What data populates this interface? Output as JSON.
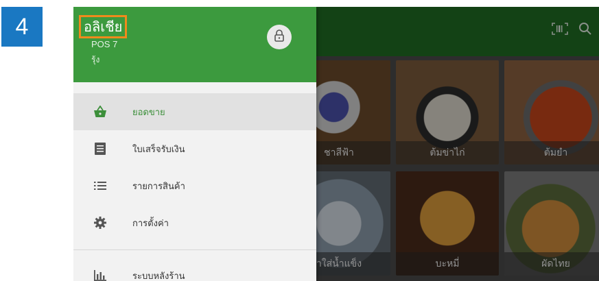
{
  "step_number": "4",
  "drawer": {
    "user_name": "อลิเชีย",
    "pos_label": "POS 7",
    "role_label": "รุ้ง",
    "menu_items": [
      {
        "label": "ยอดขาย",
        "icon": "basket-icon",
        "active": true
      },
      {
        "label": "ใบเสร็จรับเงิน",
        "icon": "receipt-icon",
        "active": false
      },
      {
        "label": "รายการสินค้า",
        "icon": "list-icon",
        "active": false
      },
      {
        "label": "การตั้งค่า",
        "icon": "gear-icon",
        "active": false
      }
    ],
    "secondary_items": [
      {
        "label": "ระบบหลังร้าน",
        "icon": "bar-chart-icon"
      }
    ]
  },
  "products": [
    {
      "label": "ชาสีฟ้า"
    },
    {
      "label": "ต้มข่าไก่"
    },
    {
      "label": "ต้มยำ"
    },
    {
      "label": "ำใส่น้ำแข็ง"
    },
    {
      "label": "บะหมี่"
    },
    {
      "label": "ผัดไทย"
    }
  ],
  "colors": {
    "header_green": "#3c9a3e",
    "app_bar_green": "#1f6b22",
    "active_green": "#3c8f3a",
    "highlight_orange": "#f08a1c",
    "badge_blue": "#1a78c2"
  }
}
